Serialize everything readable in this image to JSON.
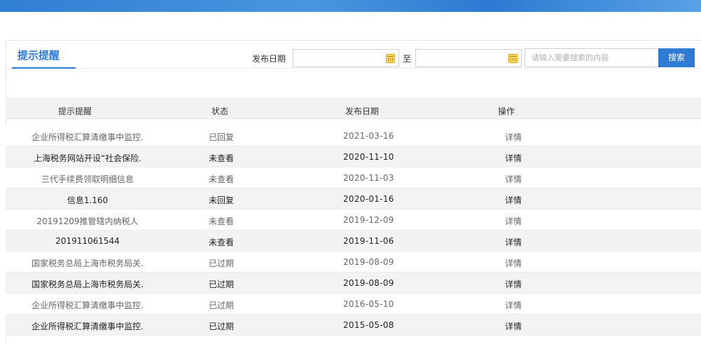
{
  "tab": {
    "title": "提示提醒"
  },
  "filter": {
    "date_label": "发布日期",
    "to_label": "至",
    "start_date": "",
    "end_date": "",
    "search_placeholder": "请输入需要搜索的内容",
    "search_button": "搜索"
  },
  "table": {
    "headers": {
      "title": "提示提醒",
      "status": "状态",
      "date": "发布日期",
      "action": "操作"
    },
    "rows": [
      {
        "title": "企业所得税汇算清缴事中监控.",
        "status": "已回复",
        "date": "2021-03-16",
        "action": "详情"
      },
      {
        "title": "上海税务网站开设“社会保险.",
        "status": "未查看",
        "date": "2020-11-10",
        "action": "详情"
      },
      {
        "title": "三代手续费领取明细信息",
        "status": "未查看",
        "date": "2020-11-03",
        "action": "详情"
      },
      {
        "title": "信息1.160",
        "status": "未回复",
        "date": "2020-01-16",
        "action": "详情"
      },
      {
        "title": "20191209推管辖内纳税人",
        "status": "未查看",
        "date": "2019-12-09",
        "action": "详情"
      },
      {
        "title": "201911061544",
        "status": "未查看",
        "date": "2019-11-06",
        "action": "详情"
      },
      {
        "title": "国家税务总局上海市税务局关.",
        "status": "已过期",
        "date": "2019-08-09",
        "action": "详情"
      },
      {
        "title": "国家税务总局上海市税务局关.",
        "status": "已过期",
        "date": "2019-08-09",
        "action": "详情"
      },
      {
        "title": "企业所得税汇算清缴事中监控.",
        "status": "已过期",
        "date": "2016-05-10",
        "action": "详情"
      },
      {
        "title": "企业所得税汇算清缴事中监控.",
        "status": "已过期",
        "date": "2015-05-08",
        "action": "详情"
      }
    ]
  }
}
